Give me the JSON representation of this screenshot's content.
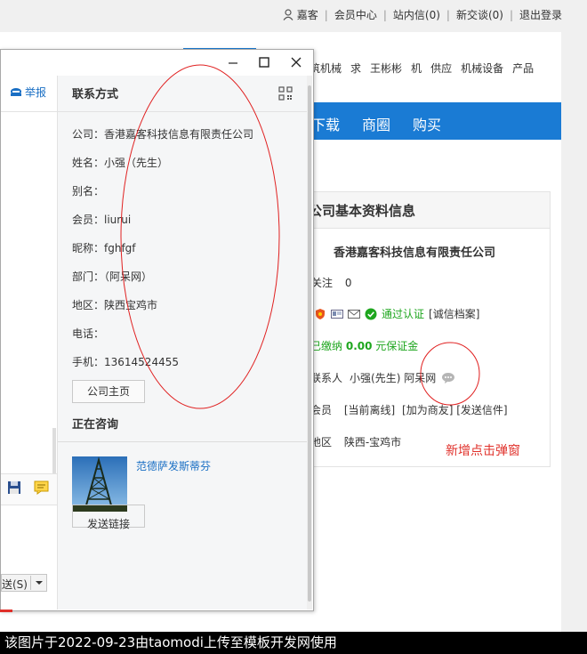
{
  "topnav": {
    "guest": "嘉客",
    "member_center": "会员中心",
    "inbox": "站内信(0)",
    "new_chat": "新交谈(0)",
    "logout": "退出登录",
    "separator": "|"
  },
  "category_nav": [
    "筑机械",
    "求",
    "王彬彬",
    "机",
    "供应",
    "机械设备",
    "产品"
  ],
  "blue_nav": [
    "下载",
    "商圈",
    "购买"
  ],
  "company_info": {
    "section_title": "公司基本资料信息",
    "company_name": "香港嘉客科技信息有限责任公司",
    "follow_label": "关注",
    "follow_count": "0",
    "verified": "通过认证",
    "credit_file": "[诚信档案]",
    "deposit_prefix": "已缴纳",
    "deposit_amount": "0.00",
    "deposit_suffix": "元保证金",
    "contact_label": "联系人",
    "contact_value": "小强(先生) 阿呆网",
    "member_label": "会员",
    "member_offline": "[当前离线]",
    "member_add_friend": "[加为商友]",
    "member_send_mail": "[发送信件]",
    "region_label": "地区",
    "region_value": "陕西-宝鸡市",
    "annotation": "新增点击弹窗"
  },
  "popup": {
    "report": "举报",
    "send_select": "送(S)",
    "contact": {
      "title": "联系方式",
      "company": "公司：香港嘉客科技信息有限责任公司",
      "name": "姓名：小强（先生）",
      "alias": "别名：",
      "member": "会员：liurui",
      "nickname": "昵称：fghfgf",
      "department": "部门：（阿呆网）",
      "region": "地区：陕西宝鸡市",
      "phone": "电话：",
      "mobile": "手机：13614524455",
      "homepage_button": "公司主页"
    },
    "consult": {
      "title": "正在咨询",
      "item_name": "范德萨发斯蒂芬",
      "send_link_button": "发送链接"
    }
  },
  "footer": "该图片于2022-09-23由taomodi上传至模板开发网使用",
  "colors": {
    "blue_nav": "#1a7bd4",
    "link_blue": "#1a6fc4",
    "annotation_red": "#e0302a",
    "verified_green": "#1ea61e",
    "ellipse_red": "#e02020"
  }
}
